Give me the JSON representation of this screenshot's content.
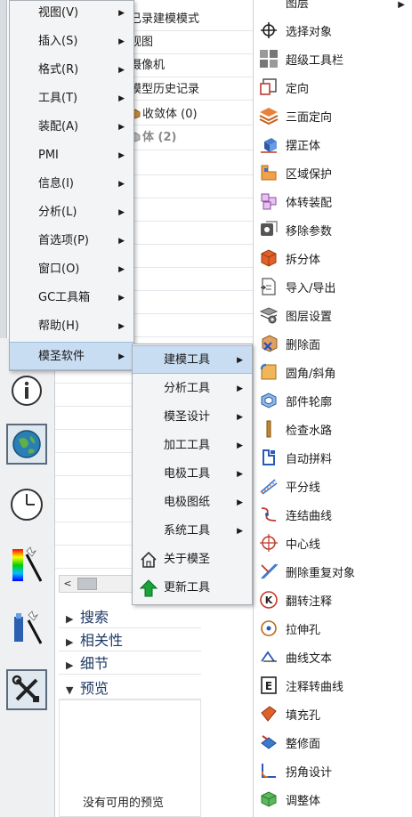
{
  "main_menu": {
    "items": [
      {
        "label": "视图(V)"
      },
      {
        "label": "插入(S)"
      },
      {
        "label": "格式(R)"
      },
      {
        "label": "工具(T)"
      },
      {
        "label": "装配(A)"
      },
      {
        "label": "PMI"
      },
      {
        "label": "信息(I)"
      },
      {
        "label": "分析(L)"
      },
      {
        "label": "首选项(P)"
      },
      {
        "label": "窗口(O)"
      },
      {
        "label": "GC工具箱"
      },
      {
        "label": "帮助(H)"
      },
      {
        "label": "模圣软件"
      }
    ],
    "active": "模圣软件"
  },
  "sub_menu": {
    "items": [
      {
        "label": "建模工具"
      },
      {
        "label": "分析工具"
      },
      {
        "label": "模圣设计"
      },
      {
        "label": "加工工具"
      },
      {
        "label": "电极工具"
      },
      {
        "label": "电极图纸"
      },
      {
        "label": "系统工具"
      },
      {
        "label": "关于模圣",
        "icon": "home-icon"
      },
      {
        "label": "更新工具",
        "icon": "up-arrow-icon"
      }
    ],
    "active": "建模工具"
  },
  "right_menu": {
    "items": [
      {
        "label": "图层",
        "icon": "layers-icon"
      },
      {
        "label": "选择对象",
        "icon": "crosshair-icon"
      },
      {
        "label": "超级工具栏",
        "icon": "toolbar-grid-icon"
      },
      {
        "label": "定向",
        "icon": "orient-box-icon"
      },
      {
        "label": "三面定向",
        "icon": "stack-layers-icon"
      },
      {
        "label": "摆正体",
        "icon": "align-body-icon"
      },
      {
        "label": "区域保护",
        "icon": "region-protect-icon"
      },
      {
        "label": "体转装配",
        "icon": "assembly-cubes-icon"
      },
      {
        "label": "移除参数",
        "icon": "remove-params-icon"
      },
      {
        "label": "拆分体",
        "icon": "split-body-icon"
      },
      {
        "label": "导入/导出",
        "icon": "import-export-icon"
      },
      {
        "label": "图层设置",
        "icon": "layer-settings-icon"
      },
      {
        "label": "删除面",
        "icon": "delete-face-icon"
      },
      {
        "label": "圆角/斜角",
        "icon": "fillet-chamfer-icon"
      },
      {
        "label": "部件轮廓",
        "icon": "part-outline-icon"
      },
      {
        "label": "检查水路",
        "icon": "check-waterline-icon"
      },
      {
        "label": "自动拼料",
        "icon": "auto-nest-icon"
      },
      {
        "label": "平分线",
        "icon": "bisector-icon"
      },
      {
        "label": "连结曲线",
        "icon": "join-curve-icon"
      },
      {
        "label": "中心线",
        "icon": "centerline-icon"
      },
      {
        "label": "删除重复对象",
        "icon": "delete-duplicate-icon"
      },
      {
        "label": "翻转注释",
        "icon": "flip-annotation-icon"
      },
      {
        "label": "拉伸孔",
        "icon": "extrude-hole-icon"
      },
      {
        "label": "曲线文本",
        "icon": "curve-text-icon"
      },
      {
        "label": "注释转曲线",
        "icon": "annotation-to-curve-icon"
      },
      {
        "label": "填充孔",
        "icon": "fill-hole-icon"
      },
      {
        "label": "整修面",
        "icon": "repair-face-icon"
      },
      {
        "label": "拐角设计",
        "icon": "corner-design-icon"
      },
      {
        "label": "调整体",
        "icon": "adjust-body-icon"
      }
    ]
  },
  "nav_tree": {
    "rows": [
      {
        "label": "已录建模模式"
      },
      {
        "label": "视图"
      },
      {
        "label": "摄像机"
      },
      {
        "label": "模型历史记录"
      },
      {
        "label": "收敛体 (0)"
      },
      {
        "label": "体 (2)"
      }
    ]
  },
  "panel_sections": [
    {
      "label": "搜索",
      "expanded": false
    },
    {
      "label": "相关性",
      "expanded": false
    },
    {
      "label": "细节",
      "expanded": false
    },
    {
      "label": "预览",
      "expanded": true
    }
  ],
  "preview": {
    "empty_text": "没有可用的预览"
  },
  "scrollbar": {
    "left_arrow": "<"
  },
  "colors": {
    "menu_highlight": "#c9ddf2",
    "section_text": "#1f3a64",
    "menu_background": "#f3f4f6"
  }
}
